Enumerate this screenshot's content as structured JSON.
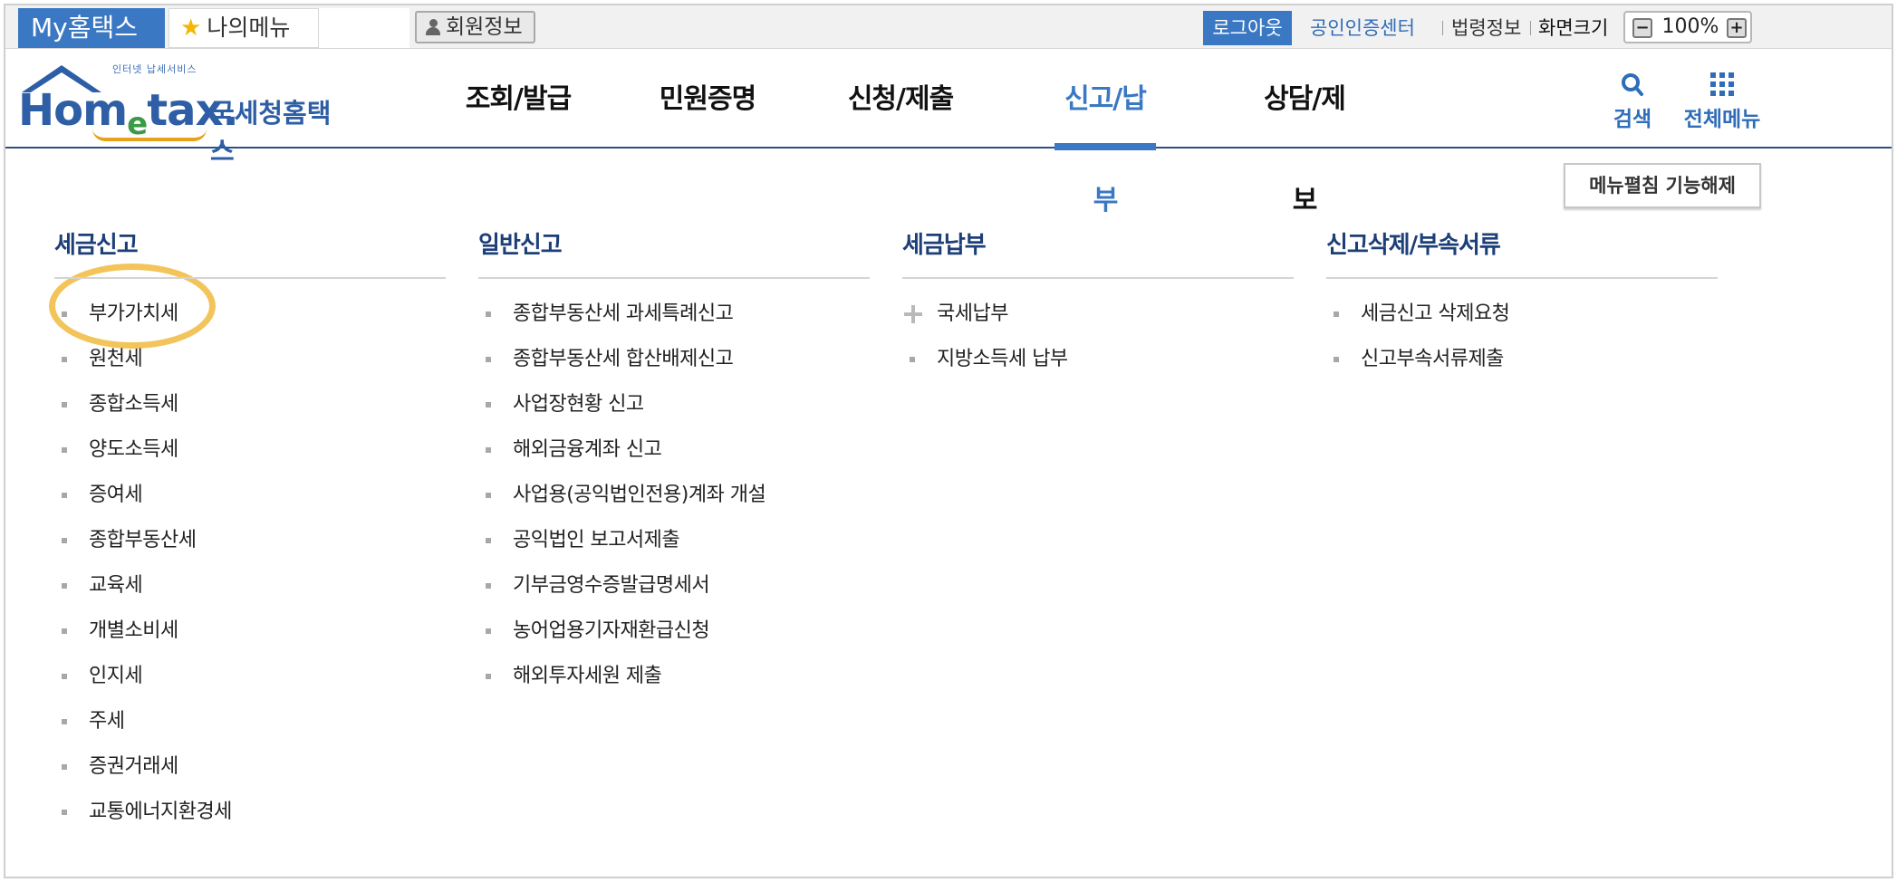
{
  "topbar": {
    "my_hometax": "My홈택스",
    "my_menu": "나의메뉴",
    "member_info": "회원정보",
    "logout": "로그아웃",
    "cert_center": "공인인증센터",
    "law_info": "법령정보",
    "screen_size_label": "화면크기",
    "zoom_minus": "−",
    "zoom_value": "100%",
    "zoom_plus": "+"
  },
  "header": {
    "logo": {
      "tagline": "인터넷 납세서비스",
      "brand_pre": "Hom",
      "brand_e": "e",
      "brand_post": "tax.",
      "korean_name": "국세청홈택스"
    },
    "nav": [
      {
        "label": "조회/발급",
        "active": false
      },
      {
        "label": "민원증명",
        "active": false
      },
      {
        "label": "신청/제출",
        "active": false
      },
      {
        "label": "신고/납부",
        "active": true
      },
      {
        "label": "상담/제보",
        "active": false
      }
    ],
    "search_label": "검색",
    "all_menu_label": "전체메뉴",
    "accent_color": "#3a78c3"
  },
  "content": {
    "unfold_button": "메뉴펼침 기능해제",
    "highlight_color": "#f2c45a",
    "columns": [
      {
        "title": "세금신고",
        "items": [
          "부가가치세",
          "원천세",
          "종합소득세",
          "양도소득세",
          "증여세",
          "종합부동산세",
          "교육세",
          "개별소비세",
          "인지세",
          "주세",
          "증권거래세",
          "교통에너지환경세"
        ]
      },
      {
        "title": "일반신고",
        "items": [
          "종합부동산세 과세특례신고",
          "종합부동산세 합산배제신고",
          "사업장현황 신고",
          "해외금융계좌 신고",
          "사업용(공익법인전용)계좌 개설",
          "공익법인 보고서제출",
          "기부금영수증발급명세서",
          "농어업용기자재환급신청",
          "해외투자세원 제출"
        ]
      },
      {
        "title": "세금납부",
        "items": [
          "국세납부",
          "지방소득세 납부"
        ]
      },
      {
        "title": "신고삭제/부속서류",
        "items": [
          "세금신고 삭제요청",
          "신고부속서류제출"
        ]
      }
    ]
  }
}
